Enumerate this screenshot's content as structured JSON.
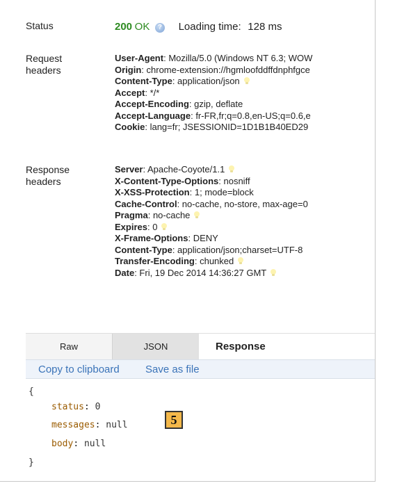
{
  "status": {
    "label": "Status",
    "code": "200",
    "text": "OK",
    "help_icon": "?",
    "loading_label": "Loading time:",
    "loading_value": "128 ms"
  },
  "request_headers": {
    "label_line1": "Request",
    "label_line2": "headers",
    "items": [
      {
        "name": "User-Agent",
        "sep": ": ",
        "value": "Mozilla/5.0 (Windows NT 6.3; WOW"
      },
      {
        "name": "Origin",
        "sep": ": ",
        "value": "chrome-extension://hgmloofddffdnphfgce"
      },
      {
        "name": "Content-Type",
        "sep": ": ",
        "value": "application/json"
      },
      {
        "name": "Accept",
        "sep": ": ",
        "value": "*/*"
      },
      {
        "name": "Accept-Encoding",
        "sep": ": ",
        "value": "gzip, deflate"
      },
      {
        "name": "Accept-Language",
        "sep": ": ",
        "value": "fr-FR,fr;q=0.8,en-US;q=0.6,e"
      },
      {
        "name": "Cookie",
        "sep": ": ",
        "value": "lang=fr; JSESSIONID=1D1B1B40ED29"
      }
    ]
  },
  "response_headers": {
    "label_line1": "Response",
    "label_line2": "headers",
    "items": [
      {
        "name": "Server",
        "sep": ": ",
        "value": "Apache-Coyote/1.1"
      },
      {
        "name": "X-Content-Type-Options",
        "sep": ": ",
        "value": "nosniff"
      },
      {
        "name": "X-XSS-Protection",
        "sep": ": ",
        "value": "1; mode=block"
      },
      {
        "name": "Cache-Control",
        "sep": ": ",
        "value": "no-cache, no-store, max-age=0"
      },
      {
        "name": "Pragma",
        "sep": ": ",
        "value": "no-cache"
      },
      {
        "name": "Expires",
        "sep": ": ",
        "value": "0"
      },
      {
        "name": "X-Frame-Options",
        "sep": ": ",
        "value": "DENY"
      },
      {
        "name": "Content-Type",
        "sep": ": ",
        "value": "application/json;charset=UTF-8"
      },
      {
        "name": "Transfer-Encoding",
        "sep": ": ",
        "value": "chunked"
      },
      {
        "name": "Date",
        "sep": ": ",
        "value": "Fri, 19 Dec 2014 14:36:27 GMT"
      }
    ]
  },
  "tabs": {
    "raw": "Raw",
    "json": "JSON",
    "response": "Response"
  },
  "actions": {
    "copy": "Copy to clipboard",
    "save": "Save as file"
  },
  "code": {
    "open": "{",
    "close": "}",
    "lines": [
      {
        "key": "status",
        "colon": ": ",
        "value": "0"
      },
      {
        "key": "messages",
        "colon": ": ",
        "value": "null"
      },
      {
        "key": "body",
        "colon": ": ",
        "value": "null"
      }
    ]
  },
  "badge": "5",
  "colors": {
    "status_ok": "#2e8b22",
    "link": "#3a73b8",
    "json_key": "#9a5b00",
    "badge": "#f4b84a"
  }
}
